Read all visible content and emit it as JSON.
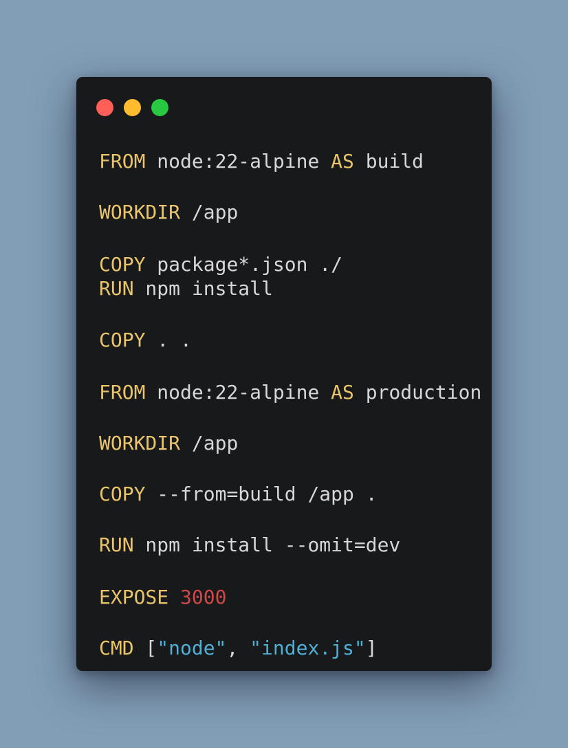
{
  "window": {
    "controls": [
      {
        "name": "close-button",
        "color": "#ff5f57"
      },
      {
        "name": "minimize-button",
        "color": "#febc2e"
      },
      {
        "name": "maximize-button",
        "color": "#28c840"
      }
    ]
  },
  "code": {
    "language": "Dockerfile",
    "lines": [
      {
        "keyword": "FROM",
        "rest": [
          {
            "t": " node:22-alpine ",
            "c": "tx"
          },
          {
            "t": "AS",
            "c": "kw"
          },
          {
            "t": " build",
            "c": "tx"
          }
        ]
      },
      {
        "keyword": "WORKDIR",
        "rest": [
          {
            "t": " /app",
            "c": "tx"
          }
        ]
      },
      {
        "keyword": "COPY",
        "rest": [
          {
            "t": " package*.json ./",
            "c": "tx"
          }
        ]
      },
      {
        "keyword": "RUN",
        "rest": [
          {
            "t": " npm install",
            "c": "tx"
          }
        ]
      },
      {
        "keyword": "COPY",
        "rest": [
          {
            "t": " . .",
            "c": "tx"
          }
        ]
      },
      {
        "keyword": "FROM",
        "rest": [
          {
            "t": " node:22-alpine ",
            "c": "tx"
          },
          {
            "t": "AS",
            "c": "kw"
          },
          {
            "t": " production",
            "c": "tx"
          }
        ]
      },
      {
        "keyword": "WORKDIR",
        "rest": [
          {
            "t": " /app",
            "c": "tx"
          }
        ]
      },
      {
        "keyword": "COPY",
        "rest": [
          {
            "t": " --from=build /app .",
            "c": "tx"
          }
        ]
      },
      {
        "keyword": "RUN",
        "rest": [
          {
            "t": " npm install --omit=dev",
            "c": "tx"
          }
        ]
      },
      {
        "keyword": "EXPOSE",
        "rest": [
          {
            "t": " ",
            "c": "tx"
          },
          {
            "t": "3000",
            "c": "num"
          }
        ]
      },
      {
        "keyword": "CMD",
        "rest": [
          {
            "t": " [",
            "c": "tx"
          },
          {
            "t": "\"node\"",
            "c": "str"
          },
          {
            "t": ", ",
            "c": "tx"
          },
          {
            "t": "\"index.js\"",
            "c": "str"
          },
          {
            "t": "]",
            "c": "tx"
          }
        ]
      }
    ]
  }
}
